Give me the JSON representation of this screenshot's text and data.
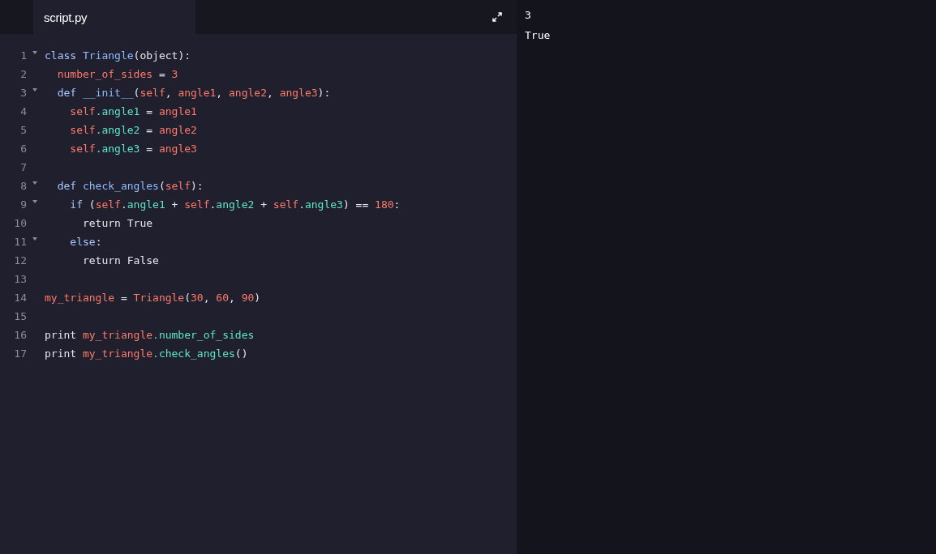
{
  "editor": {
    "tab": {
      "label": "script.py",
      "selected": true
    },
    "lines": [
      {
        "number": "1",
        "foldable": true,
        "tokens": [
          {
            "kind": "keyword",
            "text": "class "
          },
          {
            "kind": "class",
            "text": "Triangle"
          },
          {
            "kind": "plain",
            "text": "(object):"
          }
        ]
      },
      {
        "number": "2",
        "foldable": false,
        "tokens": [
          {
            "kind": "variable",
            "text": "  number_of_sides"
          },
          {
            "kind": "plain",
            "text": " = "
          },
          {
            "kind": "number",
            "text": "3"
          }
        ]
      },
      {
        "number": "3",
        "foldable": true,
        "tokens": [
          {
            "kind": "keyword",
            "text": "  def "
          },
          {
            "kind": "class",
            "text": "__init__"
          },
          {
            "kind": "plain",
            "text": "("
          },
          {
            "kind": "variable",
            "text": "self"
          },
          {
            "kind": "plain",
            "text": ", "
          },
          {
            "kind": "variable",
            "text": "angle1"
          },
          {
            "kind": "plain",
            "text": ", "
          },
          {
            "kind": "variable",
            "text": "angle2"
          },
          {
            "kind": "plain",
            "text": ", "
          },
          {
            "kind": "variable",
            "text": "angle3"
          },
          {
            "kind": "plain",
            "text": "):"
          }
        ]
      },
      {
        "number": "4",
        "foldable": false,
        "tokens": [
          {
            "kind": "variable",
            "text": "    self"
          },
          {
            "kind": "attribute",
            "text": ".angle1"
          },
          {
            "kind": "plain",
            "text": " = "
          },
          {
            "kind": "variable",
            "text": "angle1"
          }
        ]
      },
      {
        "number": "5",
        "foldable": false,
        "tokens": [
          {
            "kind": "variable",
            "text": "    self"
          },
          {
            "kind": "attribute",
            "text": ".angle2"
          },
          {
            "kind": "plain",
            "text": " = "
          },
          {
            "kind": "variable",
            "text": "angle2"
          }
        ]
      },
      {
        "number": "6",
        "foldable": false,
        "tokens": [
          {
            "kind": "variable",
            "text": "    self"
          },
          {
            "kind": "attribute",
            "text": ".angle3"
          },
          {
            "kind": "plain",
            "text": " = "
          },
          {
            "kind": "variable",
            "text": "angle3"
          }
        ]
      },
      {
        "number": "7",
        "foldable": false
      },
      {
        "number": "8",
        "foldable": true,
        "tokens": [
          {
            "kind": "keyword",
            "text": "  def "
          },
          {
            "kind": "class",
            "text": "check_angles"
          },
          {
            "kind": "plain",
            "text": "("
          },
          {
            "kind": "variable",
            "text": "self"
          },
          {
            "kind": "plain",
            "text": "):"
          }
        ]
      },
      {
        "number": "9",
        "foldable": true,
        "tokens": [
          {
            "kind": "keyword",
            "text": "    if "
          },
          {
            "kind": "plain",
            "text": "("
          },
          {
            "kind": "variable",
            "text": "self"
          },
          {
            "kind": "plain",
            "text": "."
          },
          {
            "kind": "attribute",
            "text": "angle1"
          },
          {
            "kind": "plain",
            "text": " + "
          },
          {
            "kind": "variable",
            "text": "self"
          },
          {
            "kind": "plain",
            "text": "."
          },
          {
            "kind": "attribute",
            "text": "angle2"
          },
          {
            "kind": "plain",
            "text": " + "
          },
          {
            "kind": "variable",
            "text": "self"
          },
          {
            "kind": "plain",
            "text": "."
          },
          {
            "kind": "attribute",
            "text": "angle3"
          },
          {
            "kind": "plain",
            "text": ") == "
          },
          {
            "kind": "number",
            "text": "180"
          },
          {
            "kind": "plain",
            "text": ":"
          }
        ]
      },
      {
        "number": "10",
        "foldable": false,
        "tokens": [
          {
            "kind": "plain",
            "text": "      return True"
          }
        ]
      },
      {
        "number": "11",
        "foldable": true,
        "tokens": [
          {
            "kind": "keyword",
            "text": "    else"
          },
          {
            "kind": "plain",
            "text": ":"
          }
        ]
      },
      {
        "number": "12",
        "foldable": false,
        "tokens": [
          {
            "kind": "plain",
            "text": "      return False"
          }
        ]
      },
      {
        "number": "13",
        "foldable": false
      },
      {
        "number": "14",
        "foldable": false,
        "tokens": [
          {
            "kind": "variable",
            "text": "my_triangle"
          },
          {
            "kind": "plain",
            "text": " = "
          },
          {
            "kind": "variable",
            "text": "Triangle"
          },
          {
            "kind": "plain",
            "text": "("
          },
          {
            "kind": "number",
            "text": "30"
          },
          {
            "kind": "plain",
            "text": ", "
          },
          {
            "kind": "number",
            "text": "60"
          },
          {
            "kind": "plain",
            "text": ", "
          },
          {
            "kind": "number",
            "text": "90"
          },
          {
            "kind": "plain",
            "text": ")"
          }
        ]
      },
      {
        "number": "15",
        "foldable": false
      },
      {
        "number": "16",
        "foldable": false,
        "tokens": [
          {
            "kind": "plain",
            "text": "print "
          },
          {
            "kind": "variable",
            "text": "my_triangle"
          },
          {
            "kind": "attribute",
            "text": ".number_of_sides"
          }
        ]
      },
      {
        "number": "17",
        "foldable": false,
        "tokens": [
          {
            "kind": "plain",
            "text": "print "
          },
          {
            "kind": "variable",
            "text": "my_triangle"
          },
          {
            "kind": "attribute",
            "text": ".check_angles"
          },
          {
            "kind": "plain",
            "text": "()"
          }
        ]
      }
    ]
  },
  "output": {
    "lines": [
      "3",
      "True"
    ]
  }
}
